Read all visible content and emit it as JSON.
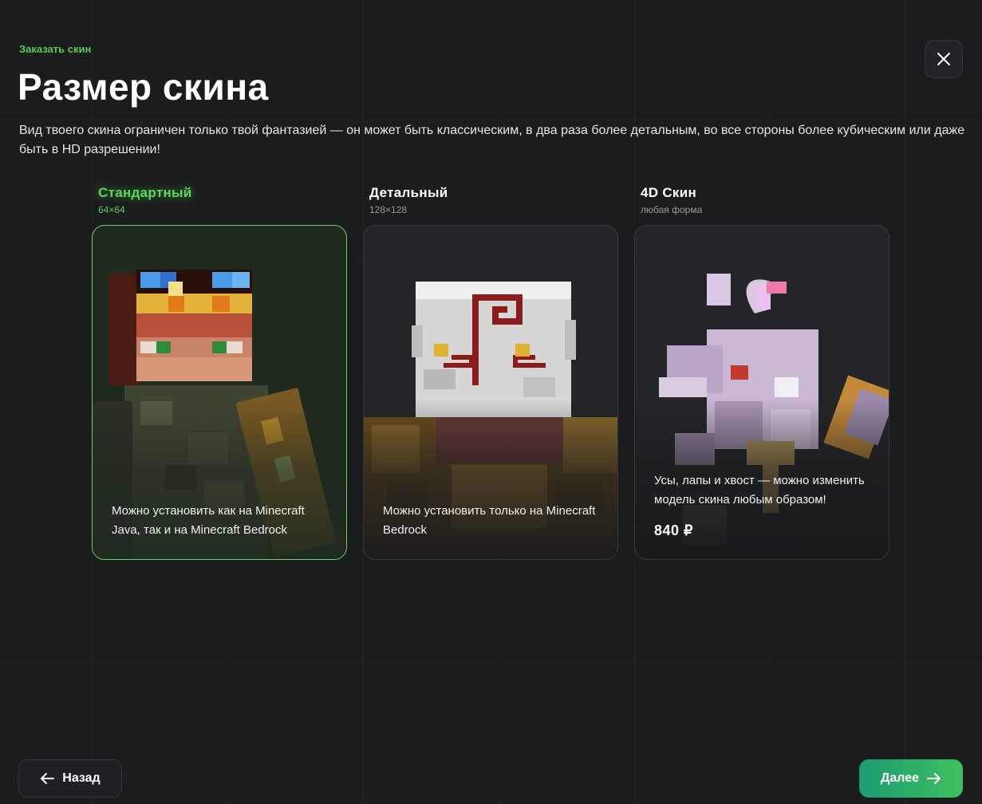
{
  "header": {
    "breadcrumb": "Заказать скин",
    "title": "Размер скина",
    "description": "Вид твоего скина ограничен только твой фантазией — он может быть классическим, в два раза более детальным, во все стороны более кубическим или даже быть в HD разрешении!"
  },
  "close_icon": "close-icon",
  "options": [
    {
      "name": "Стандартный",
      "size": "64×64",
      "text": "Можно установить как на Minecraft Java, так и на Minecraft Bedrock",
      "selected": true
    },
    {
      "name": "Детальный",
      "size": "128×128",
      "text": "Можно установить только на Minecraft Bedrock",
      "selected": false
    },
    {
      "name": "4D Скин",
      "size": "любая форма",
      "text": "Усы, лапы и хвост — можно изменить модель скина любым образом!",
      "price": "840 ₽",
      "selected": false
    }
  ],
  "footer": {
    "back_label": "Назад",
    "next_label": "Далее",
    "back_icon": "arrow-left-icon",
    "next_icon": "arrow-right-icon"
  },
  "colors": {
    "accent": "#5cc85a",
    "background": "#1b1c1e",
    "next_gradient_start": "#1c9c72",
    "next_gradient_end": "#3fc05e"
  }
}
